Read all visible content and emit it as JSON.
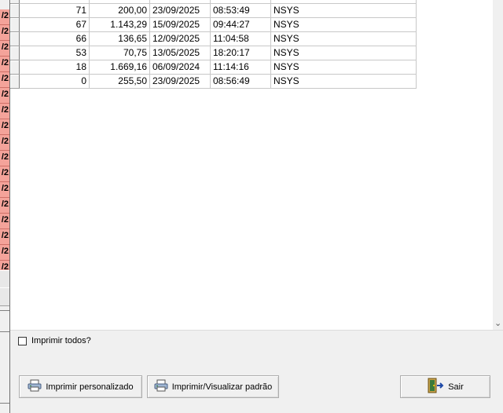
{
  "table": {
    "rows": [
      {
        "id": "71",
        "value": "200,00",
        "date": "23/09/2025",
        "time": "08:53:49",
        "user": "NSYS"
      },
      {
        "id": "67",
        "value": "1.143,29",
        "date": "15/09/2025",
        "time": "09:44:27",
        "user": "NSYS"
      },
      {
        "id": "66",
        "value": "136,65",
        "date": "12/09/2025",
        "time": "11:04:58",
        "user": "NSYS"
      },
      {
        "id": "53",
        "value": "70,75",
        "date": "13/05/2025",
        "time": "18:20:17",
        "user": "NSYS"
      },
      {
        "id": "18",
        "value": "1.669,16",
        "date": "06/09/2024",
        "time": "11:14:16",
        "user": "NSYS"
      },
      {
        "id": "0",
        "value": "255,50",
        "date": "23/09/2025",
        "time": "08:56:49",
        "user": "NSYS"
      }
    ]
  },
  "background_window": {
    "cells": [
      "/2",
      "/2",
      "/2",
      "/2",
      "/2",
      "/2",
      "/2",
      "/2",
      "/2",
      "/2",
      "/2",
      "/2",
      "/2",
      "/2",
      "/2",
      "/2",
      "/2"
    ]
  },
  "checkbox": {
    "label": "Imprimir todos?",
    "checked": false
  },
  "buttons": {
    "print_custom": "Imprimir personalizado",
    "print_standard": "Imprimir/Visualizar padrão",
    "exit": "Sair"
  },
  "icons": {
    "printer": "printer-icon",
    "exit": "exit-door-icon",
    "scroll_down": "chevron-down-icon"
  },
  "colors": {
    "highlight_red": "#f4a39a",
    "window_bg": "#f0f0f0",
    "grid_bg": "#ffffff"
  }
}
